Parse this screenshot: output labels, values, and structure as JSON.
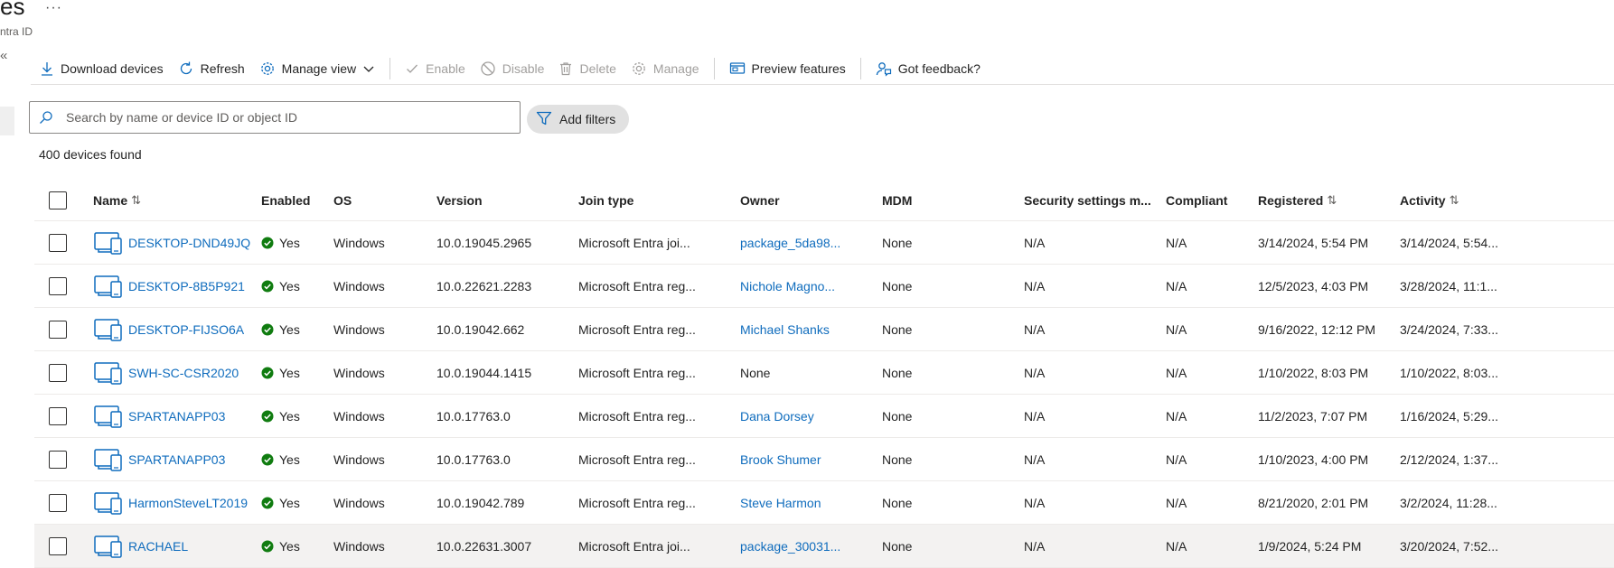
{
  "page": {
    "title": "es",
    "subtitle": "ntra ID",
    "more_label": "···",
    "collapse_label": "«"
  },
  "toolbar": {
    "download": "Download devices",
    "refresh": "Refresh",
    "manage_view": "Manage view",
    "enable": "Enable",
    "disable": "Disable",
    "delete": "Delete",
    "manage": "Manage",
    "preview": "Preview features",
    "feedback": "Got feedback?"
  },
  "search": {
    "placeholder": "Search by name or device ID or object ID",
    "value": ""
  },
  "filters": {
    "label": "Add filters"
  },
  "results": {
    "count_text": "400 devices found"
  },
  "colors": {
    "accent": "#0f6cbd",
    "enabled_green": "#107c10",
    "disabled_gray": "#a19f9d"
  },
  "columns": {
    "name": "Name",
    "enabled": "Enabled",
    "os": "OS",
    "version": "Version",
    "join_type": "Join type",
    "owner": "Owner",
    "mdm": "MDM",
    "security": "Security settings m...",
    "compliant": "Compliant",
    "registered": "Registered",
    "activity": "Activity"
  },
  "rows": [
    {
      "name": "DESKTOP-DND49JQ",
      "enabled": "Yes",
      "os": "Windows",
      "version": "10.0.19045.2965",
      "join_type": "Microsoft Entra joi...",
      "owner": "package_5da98...",
      "owner_link": true,
      "mdm": "None",
      "security": "N/A",
      "compliant": "N/A",
      "registered": "3/14/2024, 5:54 PM",
      "activity": "3/14/2024, 5:54..."
    },
    {
      "name": "DESKTOP-8B5P921",
      "enabled": "Yes",
      "os": "Windows",
      "version": "10.0.22621.2283",
      "join_type": "Microsoft Entra reg...",
      "owner": "Nichole Magno...",
      "owner_link": true,
      "mdm": "None",
      "security": "N/A",
      "compliant": "N/A",
      "registered": "12/5/2023, 4:03 PM",
      "activity": "3/28/2024, 11:1..."
    },
    {
      "name": "DESKTOP-FIJSO6A",
      "enabled": "Yes",
      "os": "Windows",
      "version": "10.0.19042.662",
      "join_type": "Microsoft Entra reg...",
      "owner": "Michael Shanks",
      "owner_link": true,
      "mdm": "None",
      "security": "N/A",
      "compliant": "N/A",
      "registered": "9/16/2022, 12:12 PM",
      "activity": "3/24/2024, 7:33..."
    },
    {
      "name": "SWH-SC-CSR2020",
      "enabled": "Yes",
      "os": "Windows",
      "version": "10.0.19044.1415",
      "join_type": "Microsoft Entra reg...",
      "owner": "None",
      "owner_link": false,
      "mdm": "None",
      "security": "N/A",
      "compliant": "N/A",
      "registered": "1/10/2022, 8:03 PM",
      "activity": "1/10/2022, 8:03..."
    },
    {
      "name": "SPARTANAPP03",
      "enabled": "Yes",
      "os": "Windows",
      "version": "10.0.17763.0",
      "join_type": "Microsoft Entra reg...",
      "owner": "Dana Dorsey",
      "owner_link": true,
      "mdm": "None",
      "security": "N/A",
      "compliant": "N/A",
      "registered": "11/2/2023, 7:07 PM",
      "activity": "1/16/2024, 5:29..."
    },
    {
      "name": "SPARTANAPP03",
      "enabled": "Yes",
      "os": "Windows",
      "version": "10.0.17763.0",
      "join_type": "Microsoft Entra reg...",
      "owner": "Brook Shumer",
      "owner_link": true,
      "mdm": "None",
      "security": "N/A",
      "compliant": "N/A",
      "registered": "1/10/2023, 4:00 PM",
      "activity": "2/12/2024, 1:37..."
    },
    {
      "name": "HarmonSteveLT2019",
      "enabled": "Yes",
      "os": "Windows",
      "version": "10.0.19042.789",
      "join_type": "Microsoft Entra reg...",
      "owner": "Steve Harmon",
      "owner_link": true,
      "mdm": "None",
      "security": "N/A",
      "compliant": "N/A",
      "registered": "8/21/2020, 2:01 PM",
      "activity": "3/2/2024, 11:28..."
    },
    {
      "name": "RACHAEL",
      "enabled": "Yes",
      "os": "Windows",
      "version": "10.0.22631.3007",
      "join_type": "Microsoft Entra joi...",
      "owner": "package_30031...",
      "owner_link": true,
      "mdm": "None",
      "security": "N/A",
      "compliant": "N/A",
      "registered": "1/9/2024, 5:24 PM",
      "activity": "3/20/2024, 7:52..."
    }
  ]
}
